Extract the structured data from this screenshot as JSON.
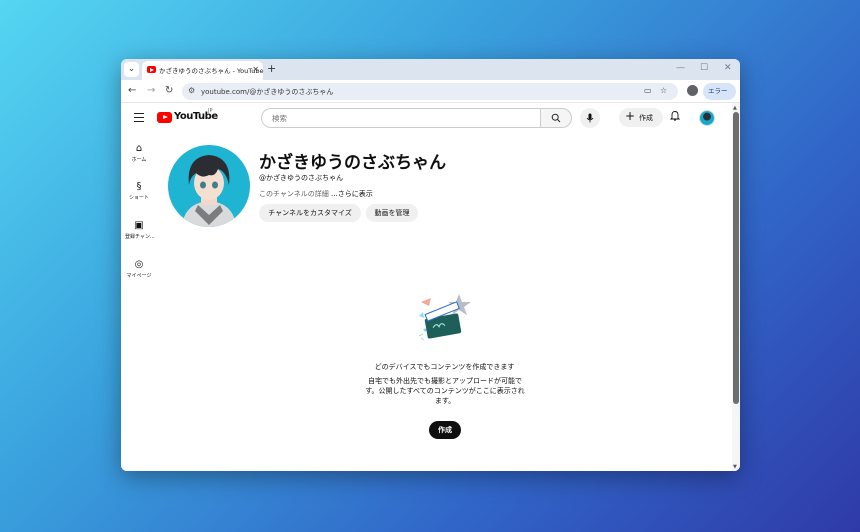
{
  "browser": {
    "tab_title": "かざきゆうのさぶちゃん - YouTube",
    "tab_menu_icon": "⌄",
    "tab_close_icon": "✕",
    "new_tab_icon": "+",
    "minimize_icon": "—",
    "maximize_icon": "☐",
    "close_icon": "✕",
    "back_icon": "←",
    "forward_icon": "→",
    "reload_icon": "↻",
    "url": "youtube.com/@かざきゆうのさぶちゃん",
    "error_chip_label": "エラー",
    "error_chip_menu": "⋮"
  },
  "header": {
    "logo_text": "YouTube",
    "logo_sup": "JP",
    "search_placeholder": "検索",
    "create_label": "作成"
  },
  "rail": {
    "items": [
      {
        "label": "ホーム",
        "icon": "⌂"
      },
      {
        "label": "ショート",
        "icon": "§"
      },
      {
        "label": "登録チャン...",
        "icon": "▣"
      },
      {
        "label": "マイページ",
        "icon": "◎"
      }
    ]
  },
  "channel": {
    "title": "かざきゆうのさぶちゃん",
    "handle": "@かざきゆうのさぶちゃん",
    "desc": "このチャンネルの詳細",
    "more": "...さらに表示",
    "customize_label": "チャンネルをカスタマイズ",
    "manage_label": "動画を管理"
  },
  "empty_state": {
    "heading": "どのデバイスでもコンテンツを作成できます",
    "body": "自宅でも外出先でも撮影とアップロードが可能です。公開したすべてのコンテンツがここに表示されます。",
    "create_label": "作成"
  },
  "colors": {
    "brand_red": "#ff0000",
    "avatar_bg": "#1fb4d2",
    "dark_button": "#0f0f0f"
  }
}
